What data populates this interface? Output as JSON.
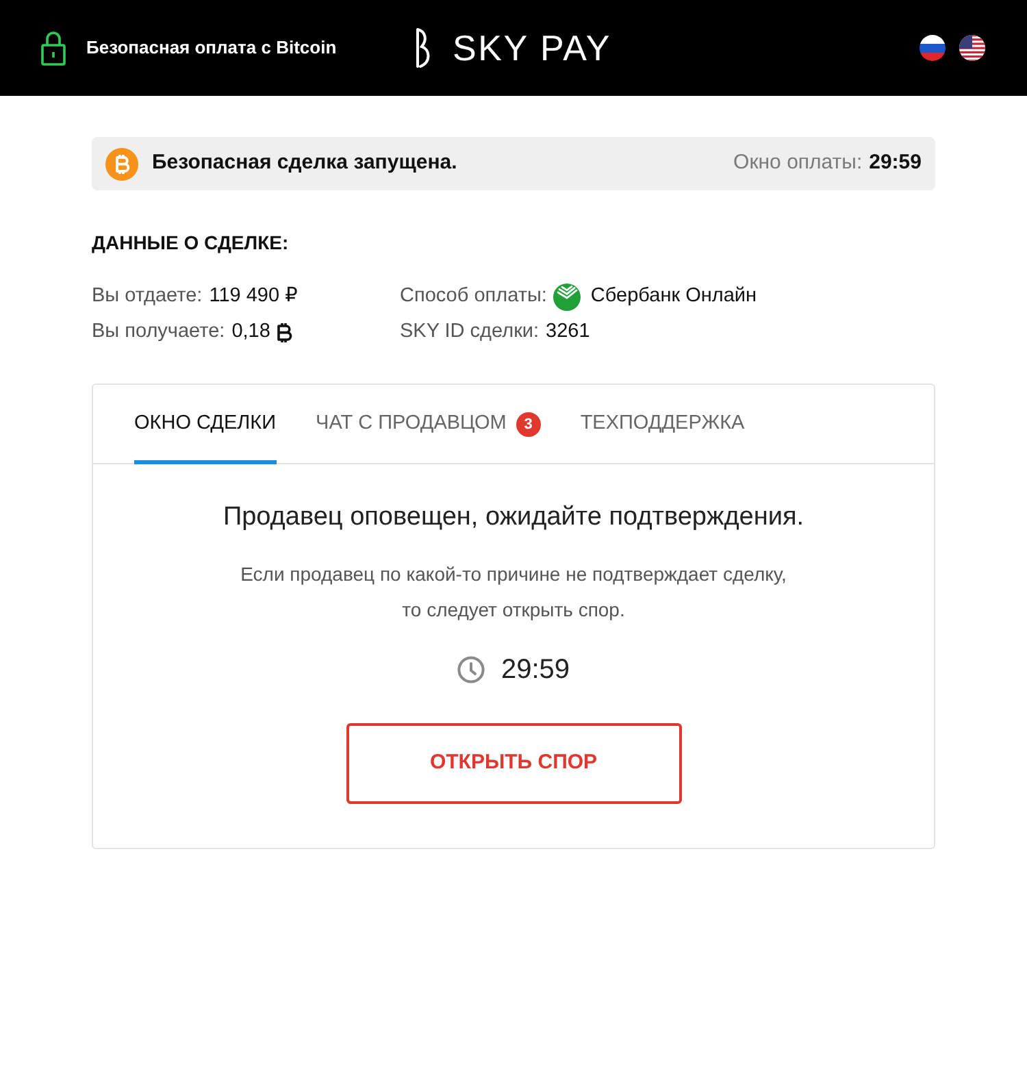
{
  "header": {
    "tagline": "Безопасная оплата с Bitcoin",
    "logo": "SKY PAY"
  },
  "notice": {
    "text": "Безопасная сделка запущена.",
    "timer_label": "Окно оплаты:",
    "timer": "29:59"
  },
  "details": {
    "title": "ДАННЫЕ О СДЕЛКЕ:",
    "columns": [
      [
        {
          "kind": "plain",
          "label": "Вы отдаете:",
          "value": "119 490 ₽"
        },
        {
          "kind": "bitcoin",
          "label": "Вы получаете:",
          "value": "0,18"
        }
      ],
      [
        {
          "kind": "bank",
          "label": "Способ оплаты:",
          "value": "Сбербанк Онлайн"
        },
        {
          "kind": "plain",
          "label": "SKY ID сделки:",
          "value": "3261"
        }
      ]
    ]
  },
  "tabs": [
    {
      "label": "ОКНО СДЕЛКИ",
      "selected": true
    },
    {
      "label": "ЧАТ С ПРОДАВЦОМ",
      "selected": false,
      "badge": "3"
    },
    {
      "label": "ТЕХПОДДЕРЖКА",
      "selected": false
    }
  ],
  "panel": {
    "heading": "Продавец оповещен, ожидайте подтверждения.",
    "text": "Если продавец по какой-то причине не подтверждает сделку,\nто следует открыть спор.",
    "timer": "29:59",
    "button": "ОТКРЫТЬ СПОР"
  }
}
